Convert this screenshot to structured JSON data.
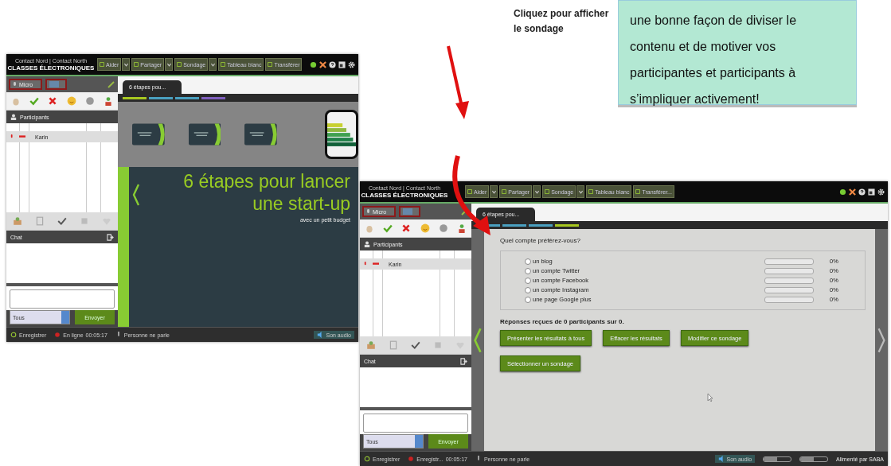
{
  "callout": {
    "text": "Cliquez pour afficher le sondage"
  },
  "note": {
    "text": "une bonne façon de diviser le contenu et de motiver vos participantes et participants à s’impliquer activement!"
  },
  "screenshots": [
    {
      "brand": {
        "top": "Contact Nord | Contact North",
        "title": "CLASSES ÉLECTRONIQUES"
      },
      "toolbar": [
        {
          "label": "Aider",
          "dropdown": true
        },
        {
          "label": "Partager",
          "dropdown": true
        },
        {
          "label": "Sondage",
          "dropdown": true
        },
        {
          "label": "Tableau blanc",
          "dropdown": false
        },
        {
          "label": "Transférer",
          "dropdown": false
        }
      ],
      "mic": {
        "label": "Micro"
      },
      "participants_header": "Participants",
      "participants": [
        {
          "name": "Karin"
        }
      ],
      "chat": {
        "title": "Chat",
        "recipient": "Tous",
        "send": "Envoyer"
      },
      "tab": {
        "label": "6 étapes pou..."
      },
      "progress": [
        {
          "color": "#a8c820"
        },
        {
          "color": "#4aa0c0"
        },
        {
          "color": "#4aa0c0"
        },
        {
          "color": "#8060c0"
        }
      ],
      "content": {
        "kind": "slide",
        "title_lines": [
          "6 étapes pour lancer",
          "une start-up"
        ],
        "subtitle": "avec un petit budget",
        "thumbnails": [
          {
            "kind": "slide"
          },
          {
            "kind": "slide"
          },
          {
            "kind": "slide"
          }
        ]
      },
      "status": [
        {
          "kind": "record",
          "label": "Enregistrer"
        },
        {
          "kind": "rec",
          "label": "En ligne",
          "time": "00:05:17"
        },
        {
          "kind": "mic",
          "label": "Personne ne parle"
        },
        {
          "kind": "audio",
          "label": "Son audio"
        }
      ]
    },
    {
      "brand": {
        "top": "Contact Nord | Contact North",
        "title": "CLASSES ÉLECTRONIQUES"
      },
      "toolbar": [
        {
          "label": "Aider",
          "dropdown": true
        },
        {
          "label": "Partager",
          "dropdown": true
        },
        {
          "label": "Sondage",
          "dropdown": true
        },
        {
          "label": "Tableau blanc",
          "dropdown": false
        },
        {
          "label": "Transférer...",
          "dropdown": false
        }
      ],
      "mic": {
        "label": "Micro"
      },
      "participants_header": "Participants",
      "participants": [
        {
          "name": "Karin"
        }
      ],
      "chat": {
        "title": "Chat",
        "recipient": "Tous",
        "send": "Envoyer"
      },
      "tab": {
        "label": "6 étapes pou..."
      },
      "progress": [
        {
          "color": "#4aa0c0"
        },
        {
          "color": "#4aa0c0"
        },
        {
          "color": "#4aa0c0"
        },
        {
          "color": "#a8c820"
        }
      ],
      "content": {
        "kind": "poll",
        "question": "Quel compte préférez-vous?",
        "options": [
          {
            "label": "un blog",
            "selected": false,
            "level": 0,
            "percent": "0%"
          },
          {
            "label": "un compte Twitter",
            "selected": false,
            "level": 0,
            "percent": "0%"
          },
          {
            "label": "un compte Facebook",
            "selected": false,
            "level": 0,
            "percent": "0%"
          },
          {
            "label": "un compte Instagram",
            "selected": false,
            "level": 0,
            "percent": "0%"
          },
          {
            "label": "une page Google plus",
            "selected": false,
            "level": 0,
            "percent": "0%"
          }
        ],
        "summary": "Réponses reçues de 0 participants sur 0.",
        "buttons": [
          "Présenter les résultats à tous",
          "Effacer les résultats",
          "Modifier ce sondage",
          "Sélectionner un sondage"
        ]
      },
      "status": [
        {
          "kind": "record",
          "label": "Enregistrer"
        },
        {
          "kind": "rec",
          "label": "Enregistr...",
          "time": "00:05:17"
        },
        {
          "kind": "mic",
          "label": "Personne ne parle"
        },
        {
          "kind": "audio",
          "label": "Son audio"
        }
      ],
      "volume": [
        {
          "level": 0.5
        },
        {
          "level": 0.5
        }
      ],
      "powered": "Alimenté par SABA"
    }
  ]
}
